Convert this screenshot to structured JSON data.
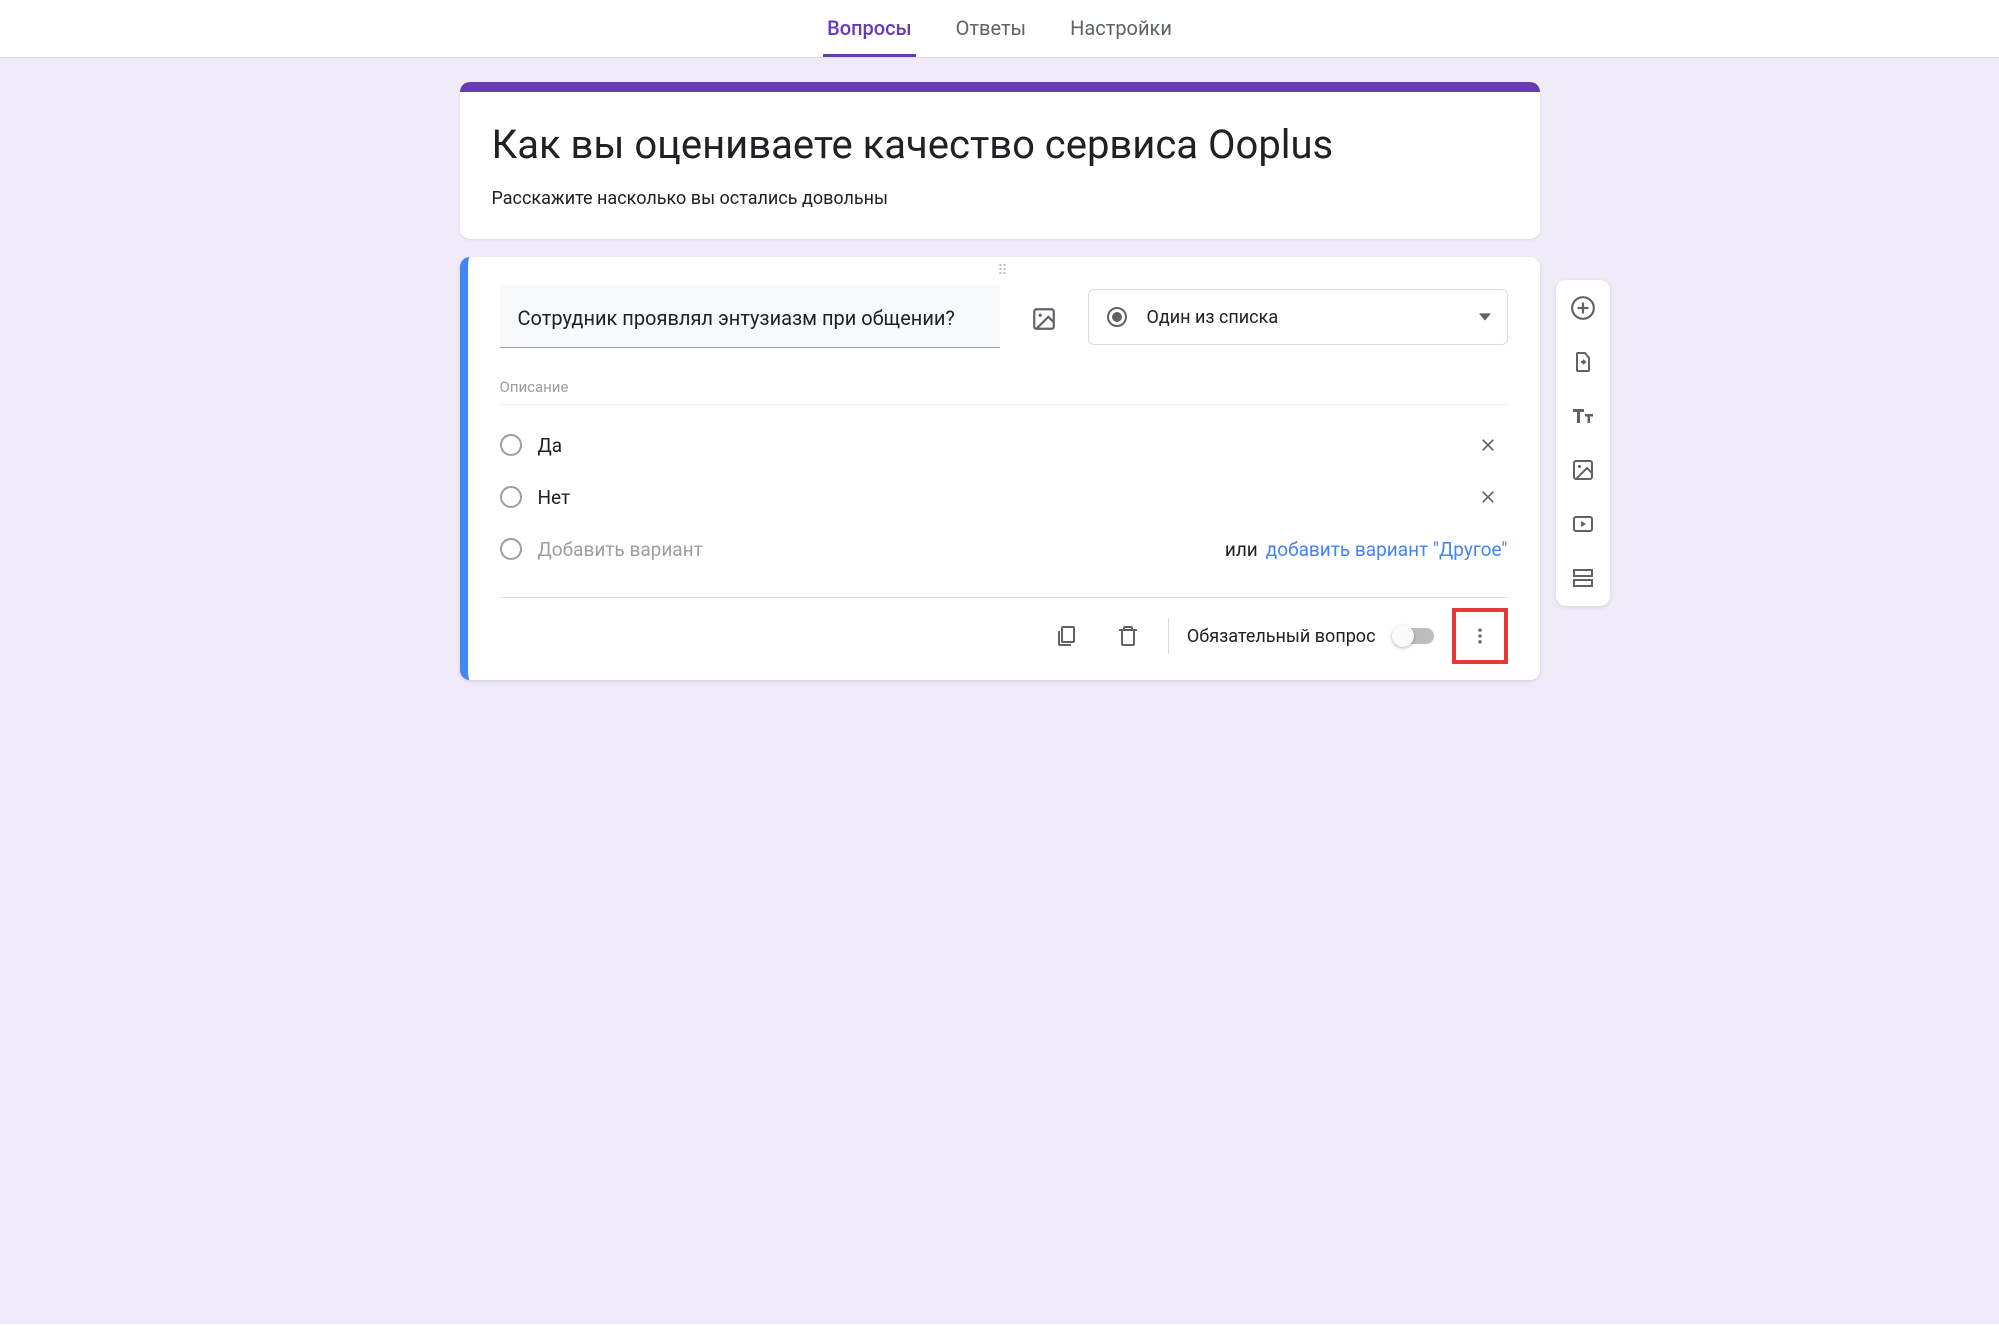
{
  "tabs": {
    "questions": "Вопросы",
    "responses": "Ответы",
    "settings": "Настройки"
  },
  "form": {
    "title": "Как вы оцениваете качество сервиса Ooplus",
    "description": "Расскажите насколько вы остались довольны"
  },
  "question": {
    "title": "Сотрудник проявлял энтузиазм при общении?",
    "description_placeholder": "Описание",
    "type_label": "Один из списка",
    "options": [
      {
        "label": "Да"
      },
      {
        "label": "Нет"
      }
    ],
    "add_option_placeholder": "Добавить вариант",
    "or_text": "или",
    "add_other_label": "добавить вариант \"Другое\"",
    "required_label": "Обязательный вопрос",
    "required": false
  },
  "toolbar_icons": {
    "add": "add-question",
    "import": "import-questions",
    "title_section": "add-title",
    "image": "add-image",
    "video": "add-video",
    "section": "add-section"
  }
}
